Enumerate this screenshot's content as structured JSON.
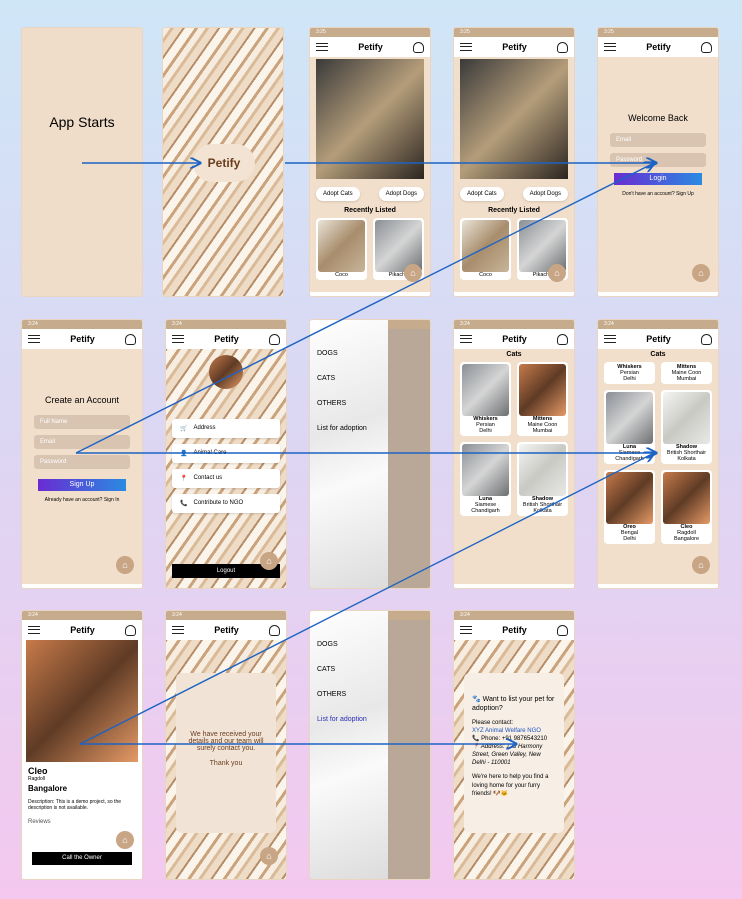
{
  "app_name": "Petify",
  "app_starts": "App Starts",
  "adopt_cats": "Adopt Cats",
  "adopt_dogs": "Adopt Dogs",
  "recently_listed": "Recently Listed",
  "pets": [
    {
      "name": "Coco"
    },
    {
      "name": "Pikachu"
    }
  ],
  "login": {
    "title": "Welcome Back",
    "email": "Email",
    "password": "Password",
    "button": "Login",
    "footer": "Don't have an account? Sign Up"
  },
  "signup": {
    "title": "Create an Account",
    "full_name": "Full Name",
    "email": "Email",
    "password": "Password",
    "button": "Sign Up",
    "footer": "Already have an account? Sign In"
  },
  "profile_menu": [
    "Address",
    "Animal Care",
    "Contact us",
    "Contribute to NGO"
  ],
  "logout": "Logout",
  "drawer_items": [
    "DOGS",
    "CATS",
    "OTHERS",
    "List for adoption"
  ],
  "cats_title": "Cats",
  "cats": [
    {
      "name": "Whiskers",
      "breed": "Persian",
      "city": "Delhi"
    },
    {
      "name": "Mittens",
      "breed": "Maine Coon",
      "city": "Mumbai"
    },
    {
      "name": "Luna",
      "breed": "Siamese",
      "city": "Chandigarh"
    },
    {
      "name": "Shadow",
      "breed": "British Shorthair",
      "city": "Kolkata"
    },
    {
      "name": "Oreo",
      "breed": "Bengal",
      "city": "Delhi"
    },
    {
      "name": "Cleo",
      "breed": "Ragdoll",
      "city": "Bangalore"
    }
  ],
  "detail": {
    "name": "Cleo",
    "breed": "Ragdoll",
    "city": "Bangalore",
    "desc": "Description: This is a demo project, so the description is not available.",
    "reviews": "Reviews",
    "button": "Call the Owner"
  },
  "received": {
    "line1": "We have received your details and our team will surely contact you.",
    "line2": "Thank you"
  },
  "list_info": {
    "heading": "🐾 Want to list your pet for adoption?",
    "contact": "Please contact:",
    "ngo": "XYZ Animal Welfare NGO",
    "phone": "📞 Phone: +91 9876543210",
    "address": "📍 Address: 123 Harmony Street, Green Valley, New Delhi - 110001",
    "closing": "We're here to help you find a loving home for your furry friends! 🐶🐱"
  }
}
